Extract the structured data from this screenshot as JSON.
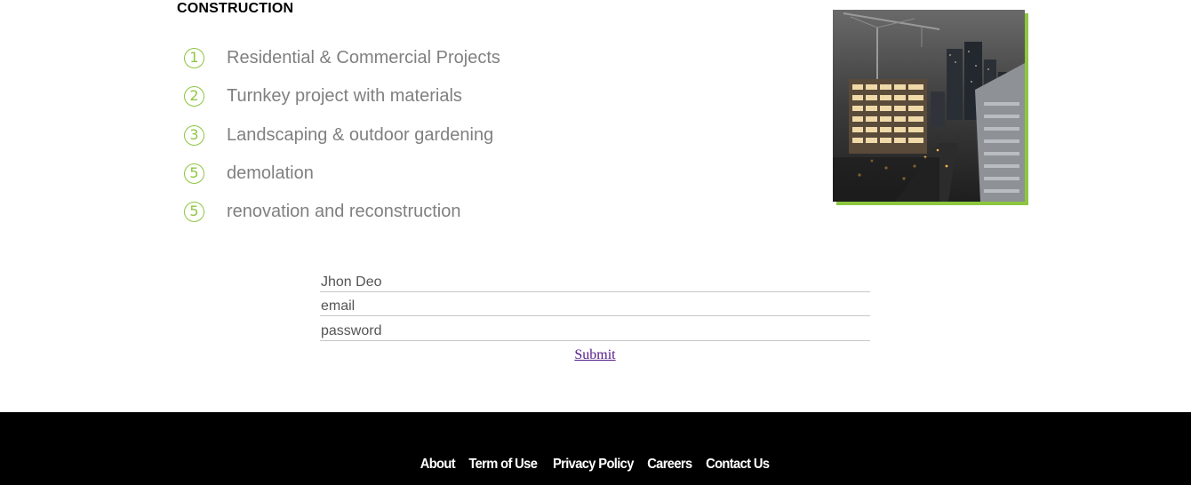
{
  "section": {
    "title": "CONSTRUCTION"
  },
  "services": [
    {
      "number": "1",
      "label": "Residential & Commercial Projects"
    },
    {
      "number": "2",
      "label": "Turnkey project with materials"
    },
    {
      "number": "3",
      "label": "Landscaping & outdoor gardening"
    },
    {
      "number": "5",
      "label": "demolation"
    },
    {
      "number": "5",
      "label": "renovation and reconstruction"
    }
  ],
  "form": {
    "name_placeholder": "Jhon Deo",
    "email_placeholder": "email",
    "password_placeholder": "password",
    "submit_label": "Submit"
  },
  "footer": {
    "links": [
      "About",
      "Term of Use",
      "Privacy Policy",
      "Careers",
      "Contact Us"
    ]
  },
  "colors": {
    "accent": "#8dc63f",
    "footer_bg": "#000000",
    "service_text": "#808080"
  }
}
